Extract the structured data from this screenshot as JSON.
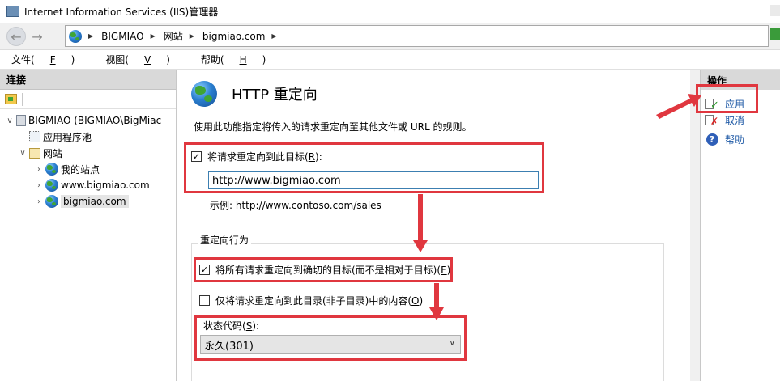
{
  "window": {
    "title": "Internet Information Services (IIS)管理器"
  },
  "address": {
    "crumbs": [
      "BIGMIAO",
      "网站",
      "bigmiao.com"
    ]
  },
  "menu": [
    {
      "text": "文件(",
      "key": "F",
      "end": ")"
    },
    {
      "text": "视图(",
      "key": "V",
      "end": ")"
    },
    {
      "text": "帮助(",
      "key": "H",
      "end": ")"
    }
  ],
  "connections": {
    "header": "连接",
    "tree": {
      "server": "BIGMIAO (BIGMIAO\\BigMiac",
      "app_pools": "应用程序池",
      "sites": "网站",
      "site1": "我的站点",
      "site2": "www.bigmiao.com",
      "site3": "bigmiao.com"
    }
  },
  "feature": {
    "title": "HTTP 重定向",
    "description": "使用此功能指定将传入的请求重定向至其他文件或 URL 的规则。",
    "redirect_checkbox": {
      "label_pre": "将请求重定向到此目标(",
      "key": "R",
      "label_post": "):",
      "checked": true
    },
    "url": "http://www.bigmiao.com",
    "example": "示例: http://www.contoso.com/sales",
    "behavior_group": "重定向行为",
    "exact_checkbox": {
      "label_pre": "将所有请求重定向到确切的目标(而不是相对于目标)(",
      "key": "E",
      "label_post": ")",
      "checked": true
    },
    "only_dir_checkbox": {
      "label_pre": "仅将请求重定向到此目录(非子目录)中的内容(",
      "key": "O",
      "label_post": ")",
      "checked": false
    },
    "status_label": {
      "pre": "状态代码(",
      "key": "S",
      "post": "):"
    },
    "status_value": "永久(301)"
  },
  "actions": {
    "header": "操作",
    "apply": "应用",
    "cancel": "取消",
    "help": "帮助"
  },
  "colors": {
    "annotation": "#e0373f",
    "link": "#1f5aa6"
  }
}
